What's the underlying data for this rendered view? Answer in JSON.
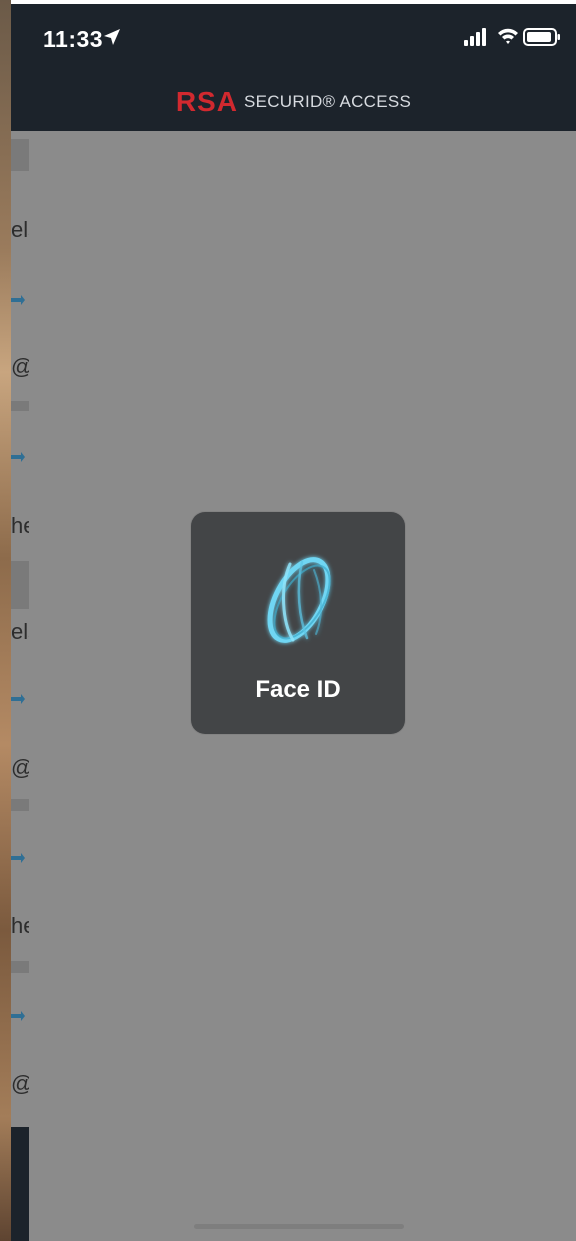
{
  "status_bar": {
    "time": "11:33",
    "icons": [
      "location-arrow-icon",
      "cellular-signal-icon",
      "wifi-icon",
      "battery-icon"
    ]
  },
  "header": {
    "brand_logo": "RSA",
    "brand_text": "SECURID® ACCESS",
    "background_color": "#1c232b",
    "logo_color": "#d1292f"
  },
  "background_list": {
    "fragments": [
      "els",
      "@c",
      "he",
      "els",
      "@c",
      "he",
      "@c"
    ]
  },
  "faceid_prompt": {
    "label": "Face ID",
    "icon": "face-id-glyph-icon",
    "accent_color": "#6fd6f3"
  }
}
